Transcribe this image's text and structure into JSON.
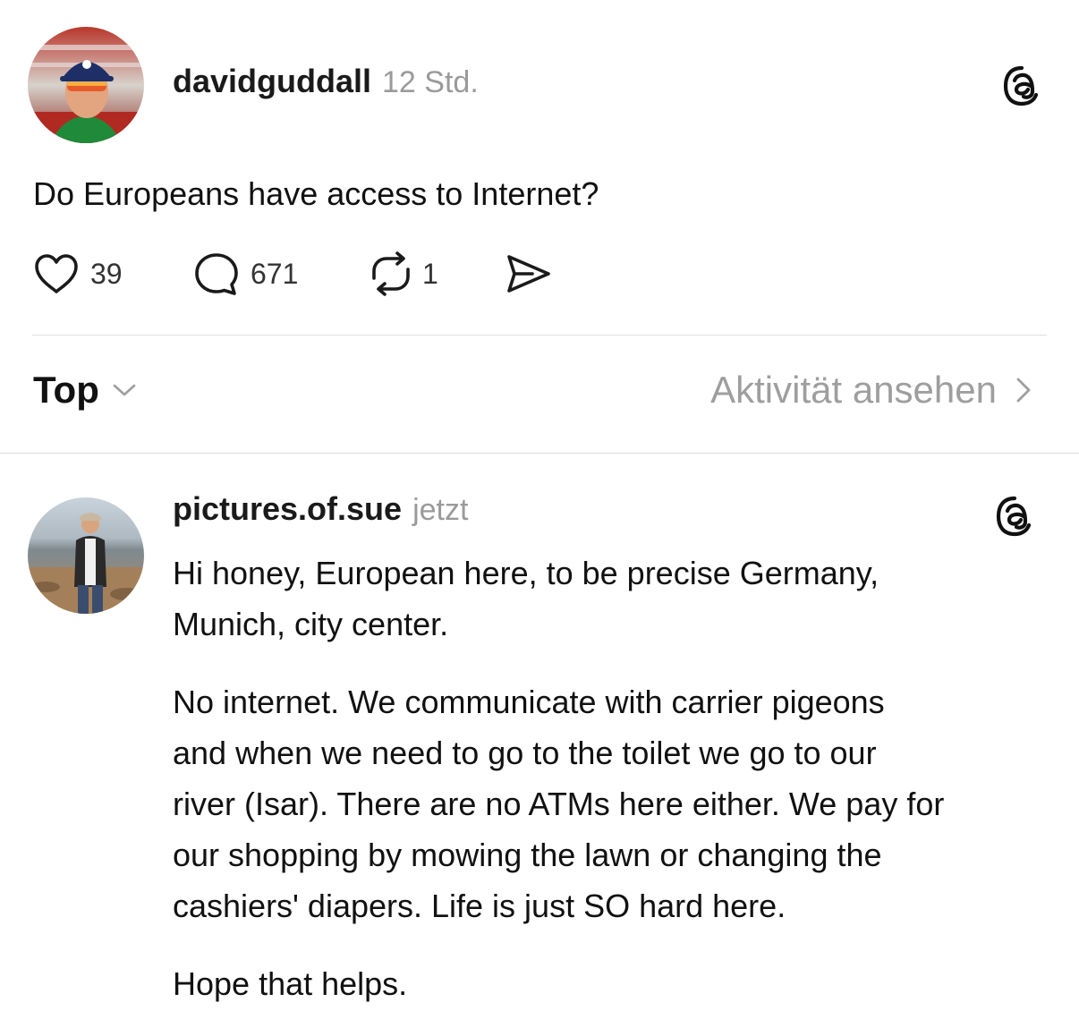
{
  "post": {
    "author": "davidguddall",
    "time": "12 Std.",
    "text": "Do Europeans have access to Internet?",
    "likes": "39",
    "replies": "671",
    "reposts": "1",
    "avatar_icon": "profile-photo"
  },
  "sort": {
    "label": "Top",
    "activity_label": "Aktivität ansehen"
  },
  "reply": {
    "author": "pictures.of.sue",
    "time": "jetzt",
    "paragraphs": [
      "Hi honey, European here, to be precise Germany,\nMunich, city center.",
      "No internet. We communicate with carrier pigeons\nand when we need to go to the toilet we go to our\nriver (Isar). There are no ATMs here either. We pay for\nour shopping by mowing the lawn or changing the\ncashiers' diapers. Life is just SO hard here.",
      "Hope that helps."
    ],
    "avatar_icon": "profile-photo"
  },
  "icons": {
    "like": "heart-icon",
    "reply": "comment-icon",
    "repost": "repost-icon",
    "share": "send-icon",
    "brand": "threads-logo-icon"
  }
}
